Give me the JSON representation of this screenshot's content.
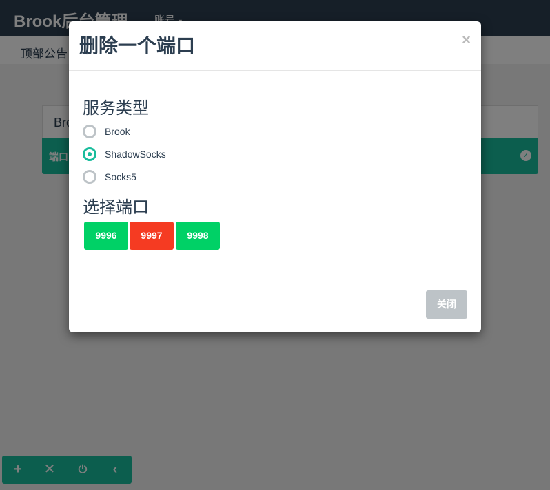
{
  "app": {
    "brand": "Brook后台管理",
    "account_menu": "账号",
    "notice": "顶部公告",
    "panel_title": "Brook",
    "panel_row_label": "端口"
  },
  "toolbar": {
    "add_icon": "plus-icon",
    "remove_icon": "close-icon",
    "power_icon": "power-icon",
    "collapse_icon": "chevron-left-icon"
  },
  "modal": {
    "title": "删除一个端口",
    "close_symbol": "×",
    "service_type_title": "服务类型",
    "service_types": [
      {
        "label": "Brook",
        "checked": false
      },
      {
        "label": "ShadowSocks",
        "checked": true
      },
      {
        "label": "Socks5",
        "checked": false
      }
    ],
    "port_title": "选择端口",
    "ports": [
      {
        "label": "9996",
        "color": "#00d166"
      },
      {
        "label": "9997",
        "color": "#f53b22"
      },
      {
        "label": "9998",
        "color": "#00d166"
      }
    ],
    "close_button": "关闭"
  },
  "colors": {
    "primary": "#18bc9c",
    "navbar": "#2c3e50",
    "success": "#00d166",
    "danger": "#f53b22",
    "muted": "#bdc3c7"
  }
}
